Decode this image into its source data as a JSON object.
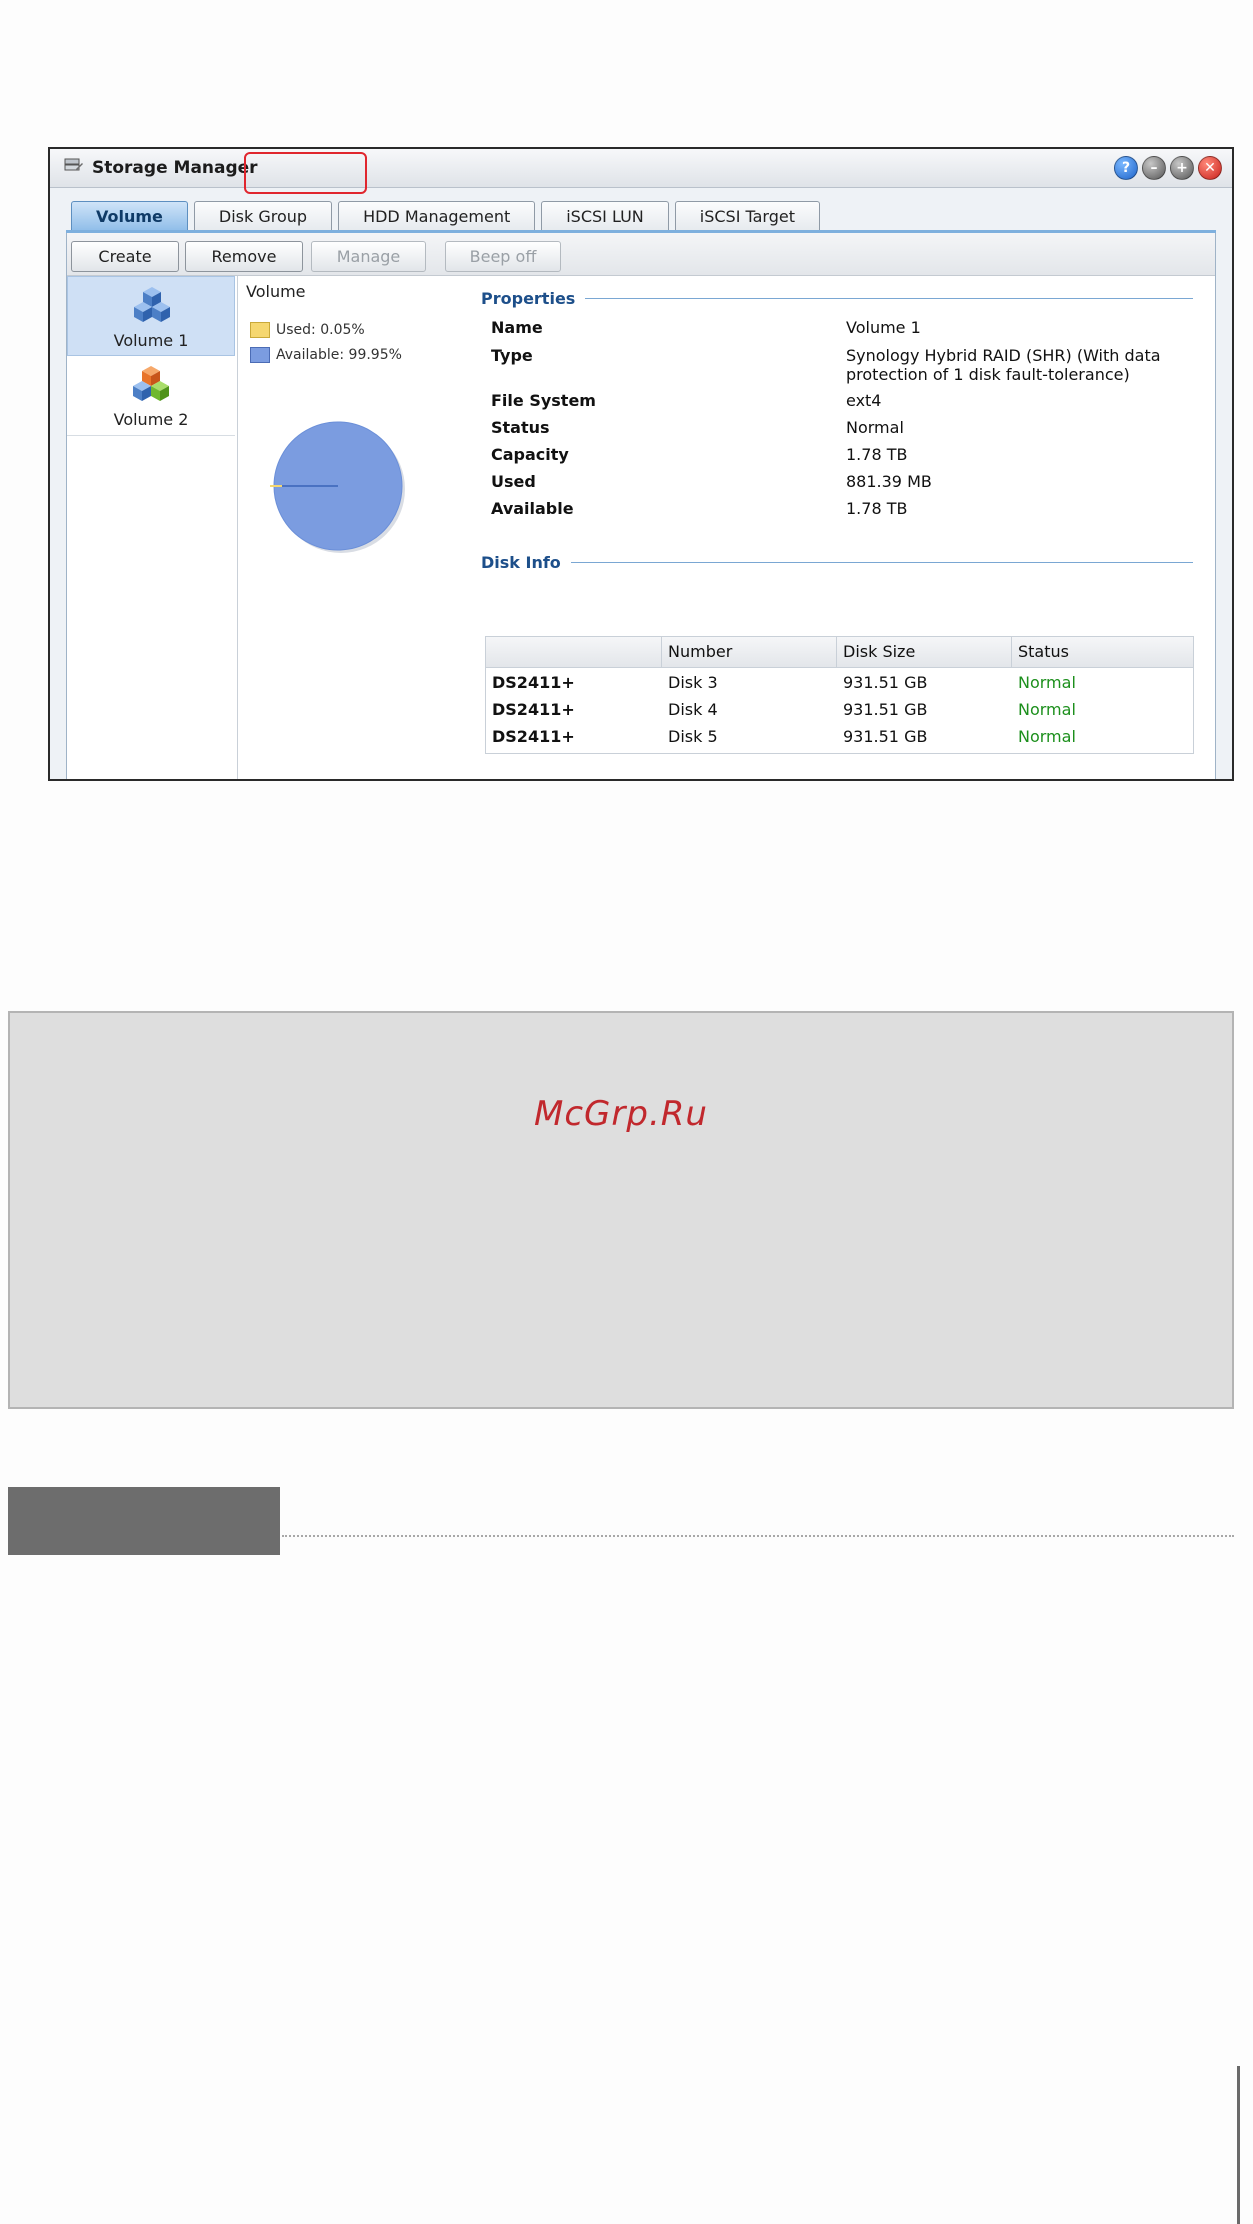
{
  "window": {
    "title": "Storage Manager",
    "title_buttons": [
      {
        "name": "help-icon",
        "glyph": "?"
      },
      {
        "name": "minimize-icon",
        "glyph": "–"
      },
      {
        "name": "maximize-icon",
        "glyph": "+"
      },
      {
        "name": "close-icon",
        "glyph": "✕"
      }
    ]
  },
  "tabs": [
    {
      "label": "Volume",
      "active": true
    },
    {
      "label": "Disk Group",
      "active": false
    },
    {
      "label": "HDD Management",
      "active": false
    },
    {
      "label": "iSCSI LUN",
      "active": false
    },
    {
      "label": "iSCSI Target",
      "active": false
    }
  ],
  "toolbar": {
    "create": "Create",
    "remove": "Remove",
    "manage": "Manage",
    "beep_off": "Beep off"
  },
  "sidebar": {
    "items": [
      {
        "label": "Volume 1",
        "icon": "volume-blue-cubes-icon",
        "selected": true
      },
      {
        "label": "Volume 2",
        "icon": "volume-color-cubes-icon",
        "selected": false
      }
    ]
  },
  "usage": {
    "title": "Volume",
    "used_label": "Used: 0.05%",
    "available_label": "Available: 99.95%",
    "used_color": "#f5d770",
    "available_color": "#7b9ce0"
  },
  "chart_data": {
    "type": "pie",
    "labels": [
      "Used",
      "Available"
    ],
    "values": [
      0.05,
      99.95
    ]
  },
  "properties": {
    "heading": "Properties",
    "name_key": "Name",
    "name_val": "Volume 1",
    "type_key": "Type",
    "type_val": "Synology Hybrid RAID (SHR) (With data protection of 1 disk fault-tolerance)",
    "fs_key": "File System",
    "fs_val": "ext4",
    "status_key": "Status",
    "status_val": "Normal",
    "capacity_key": "Capacity",
    "capacity_val": "1.78 TB",
    "used_key": "Used",
    "used_val": "881.39 MB",
    "available_key": "Available",
    "available_val": "1.78 TB"
  },
  "disk_info": {
    "heading": "Disk Info",
    "columns": [
      "",
      "Number",
      "Disk Size",
      "Status"
    ],
    "rows": [
      {
        "model": "DS2411+",
        "number": "Disk 3",
        "size": "931.51 GB",
        "status": "Normal"
      },
      {
        "model": "DS2411+",
        "number": "Disk 4",
        "size": "931.51 GB",
        "status": "Normal"
      },
      {
        "model": "DS2411+",
        "number": "Disk 5",
        "size": "931.51 GB",
        "status": "Normal"
      }
    ]
  },
  "watermark": "McGrp.Ru",
  "colors": {
    "highlight": "#e0262e",
    "status_ok": "#1c8f1c",
    "section_bar": "#6d6d6d"
  }
}
